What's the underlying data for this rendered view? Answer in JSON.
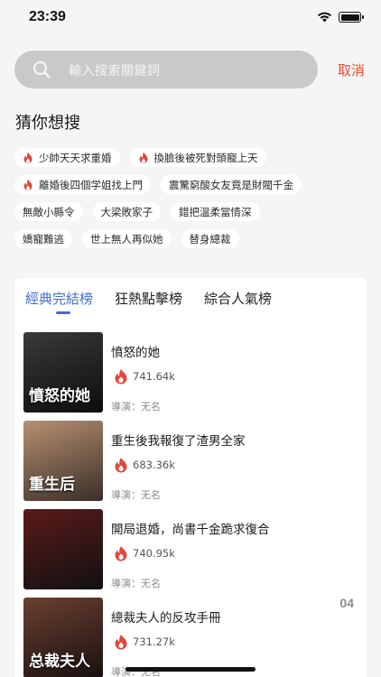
{
  "status_bar": {
    "time": "23:39"
  },
  "search": {
    "placeholder": "輸入搜索關鍵詞",
    "cancel_label": "取消"
  },
  "suggestions": {
    "title": "猜你想搜",
    "rows": [
      [
        {
          "label": "少帥天天求重婚",
          "hot": true
        },
        {
          "label": "換臉後被死對頭寵上天",
          "hot": true
        }
      ],
      [
        {
          "label": "離婚後四個学姐找上門",
          "hot": true
        },
        {
          "label": "震驚窮酸女友竟是財閥千金",
          "hot": false
        }
      ],
      [
        {
          "label": "無敵小縣令",
          "hot": false
        },
        {
          "label": "大梁敗家子",
          "hot": false
        },
        {
          "label": "錯把溫柔當情深",
          "hot": false
        }
      ],
      [
        {
          "label": "嬌寵難逃",
          "hot": false
        },
        {
          "label": "世上無人再似她",
          "hot": false
        },
        {
          "label": "替身總裁",
          "hot": false
        }
      ]
    ]
  },
  "rank": {
    "tabs": [
      {
        "label": "經典完結榜",
        "active": true
      },
      {
        "label": "狂熱點擊榜",
        "active": false
      },
      {
        "label": "綜合人氣榜",
        "active": false
      }
    ],
    "books": [
      {
        "title": "憤怒的她",
        "heat": "741.64k",
        "director": "導演：无名",
        "cover_text": "憤怒的她",
        "cover_colors": [
          "#3a3a3a",
          "#0d0d0d"
        ]
      },
      {
        "title": "重生後我報復了渣男全家",
        "heat": "683.36k",
        "director": "導演：无名",
        "cover_text": "重生后",
        "cover_colors": [
          "#b89070",
          "#3a2f2a"
        ]
      },
      {
        "title": "開局退婚，尚書千金跪求復合",
        "heat": "740.95k",
        "director": "導演：无名",
        "cover_text": "",
        "cover_colors": [
          "#5a1a1a",
          "#111111"
        ]
      },
      {
        "title": "總裁夫人的反攻手冊",
        "heat": "731.27k",
        "director": "導演：无名",
        "cover_text": "总裁夫人",
        "cover_colors": [
          "#6a4030",
          "#1a1010"
        ]
      }
    ],
    "rank_number": "04"
  },
  "colors": {
    "accent": "#3f6fd1",
    "cancel": "#e2502b",
    "hot": "#e2473a"
  }
}
